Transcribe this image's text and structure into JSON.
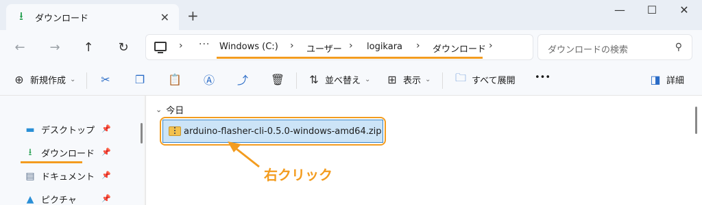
{
  "tab": {
    "title": "ダウンロード",
    "icon": "download-icon"
  },
  "window_controls": {
    "new_tab": "+",
    "minimize": "—",
    "maximize": "☐",
    "close": "✕",
    "tab_close": "✕"
  },
  "nav": {
    "back": "←",
    "forward": "→",
    "up": "↑",
    "refresh": "↻"
  },
  "address": {
    "dots": "···",
    "breadcrumbs": [
      "Windows (C:)",
      "ユーザー",
      "logikara",
      "ダウンロード"
    ],
    "highlight_color": "#f39c1f"
  },
  "search": {
    "placeholder": "ダウンロードの検索",
    "icon": "search-icon"
  },
  "toolbar": {
    "new_label": "新規作成",
    "sort_label": "並べ替え",
    "view_label": "表示",
    "extract_label": "すべて展開",
    "more_label": "•••",
    "details_label": "詳細"
  },
  "sidebar": {
    "items": [
      {
        "label": "デスクトップ",
        "icon": "desktop-icon"
      },
      {
        "label": "ダウンロード",
        "icon": "download-icon"
      },
      {
        "label": "ドキュメント",
        "icon": "document-icon"
      },
      {
        "label": "ピクチャ",
        "icon": "picture-icon"
      }
    ],
    "pin_icon": "pin-icon"
  },
  "main": {
    "group_header": "今日",
    "files": [
      {
        "name": "arduino-flasher-cli-0.5.0-windows-amd64.zip",
        "icon": "zip-folder-icon",
        "selected": true
      }
    ],
    "annotation": "右クリック",
    "annotation_color": "#f39c1f",
    "selection_color": "#cce4f7"
  }
}
